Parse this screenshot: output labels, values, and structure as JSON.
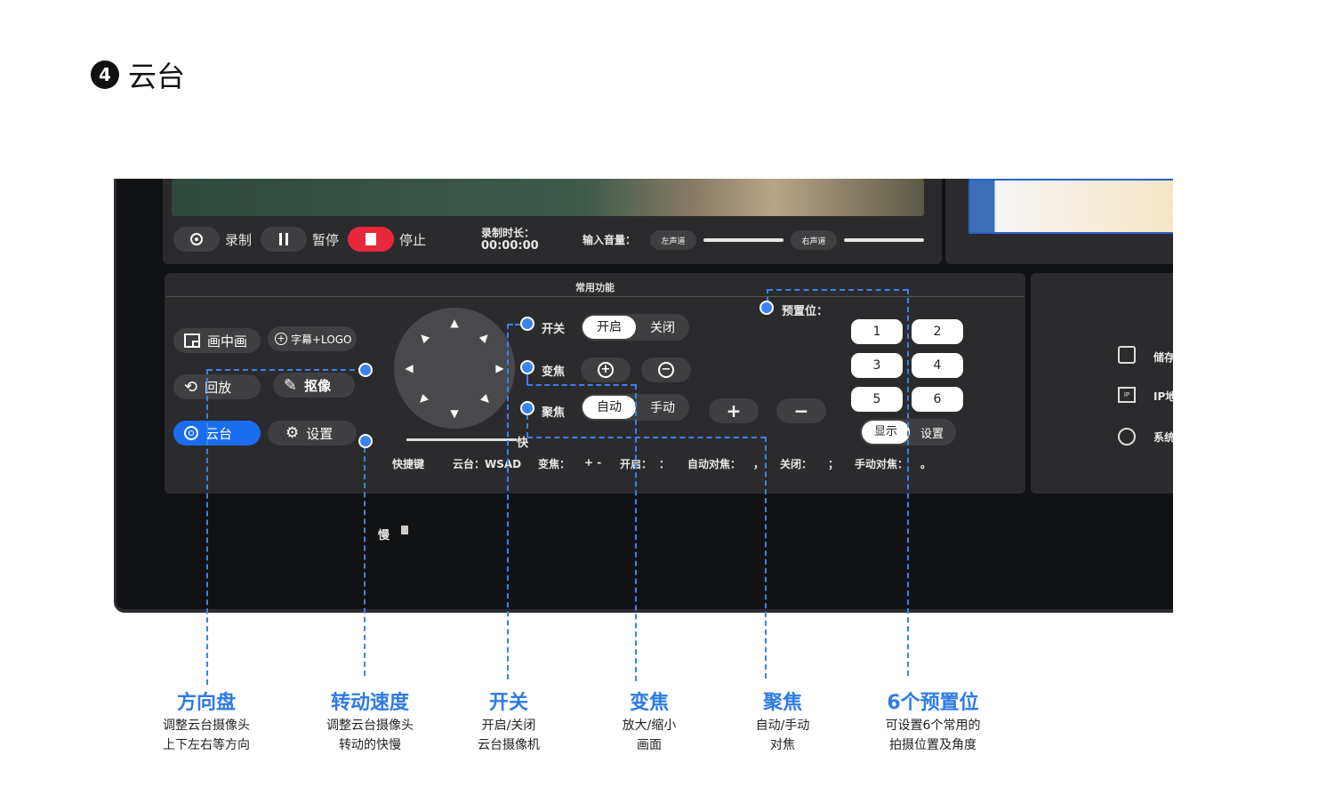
{
  "heading": {
    "number": "4",
    "title": "云台"
  },
  "recording": {
    "record_label": "录制",
    "pause_label": "暂停",
    "stop_label": "停止",
    "duration_label": "录制时长：",
    "duration_value": "00:00:00",
    "input_volume_label": "输入音量：",
    "left_channel": "左声道",
    "right_channel": "右声道"
  },
  "functions": {
    "title": "常用功能",
    "pip_label": "画中画",
    "caption_logo_label": "字幕+LOGO",
    "playback_label": "回放",
    "matting_label": "抠像",
    "ptz_label": "云台",
    "settings_label": "设置",
    "switch_label": "开关",
    "switch_on": "开启",
    "switch_off": "关闭",
    "zoom_label": "变焦",
    "focus_label": "聚焦",
    "focus_auto": "自动",
    "focus_manual": "手动",
    "plus": "+",
    "minus": "−",
    "slow_label": "慢",
    "fast_label": "快",
    "preset_label": "预置位：",
    "presets": [
      "1",
      "2",
      "3",
      "4",
      "5",
      "6"
    ],
    "show_label": "显示",
    "preset_settings_label": "设置",
    "shortcut_title": "快捷键",
    "shortcut_ptz": "云台：WSAD",
    "shortcut_zoom_label": "变焦：",
    "shortcut_zoom_keys": "+ -",
    "shortcut_on_label": "开启：",
    "shortcut_on_key": "：",
    "shortcut_autofocus_label": "自动对焦：",
    "shortcut_autofocus_key": "，",
    "shortcut_off_label": "关闭：",
    "shortcut_off_key": "；",
    "shortcut_manualfocus_label": "手动对焦：",
    "shortcut_manualfocus_key": "。"
  },
  "right_menu": {
    "storage": "储存",
    "ip": "IP地",
    "system": "系统"
  },
  "captions": [
    {
      "title": "方向盘",
      "line1": "调整云台摄像头",
      "line2": "上下左右等方向"
    },
    {
      "title": "转动速度",
      "line1": "调整云台摄像头",
      "line2": "转动的快慢"
    },
    {
      "title": "开关",
      "line1": "开启/关闭",
      "line2": "云台摄像机"
    },
    {
      "title": "变焦",
      "line1": "放大/缩小",
      "line2": "画面"
    },
    {
      "title": "聚焦",
      "line1": "自动/手动",
      "line2": "对焦"
    },
    {
      "title": "6个预置位",
      "line1": "可设置6个常用的",
      "line2": "拍摄位置及角度"
    }
  ],
  "colors": {
    "accent": "#3b82ee",
    "active_button": "#1b6df0",
    "stop_red": "#e8283a",
    "panel": "#2b2b2d"
  }
}
